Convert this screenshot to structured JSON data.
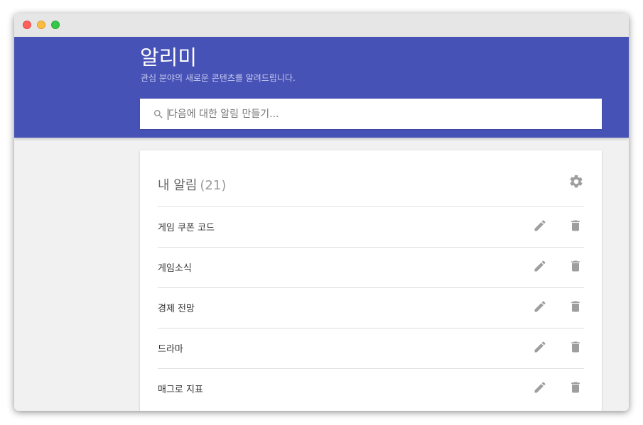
{
  "app": {
    "title": "알리미",
    "subtitle": "관심 분야의 새로운 콘텐츠를 알려드립니다."
  },
  "search": {
    "placeholder": "다음에 대한 알림 만들기...",
    "icon": "search-icon"
  },
  "alerts_card": {
    "title": "내 알림",
    "count": "(21)",
    "settings_icon": "gear-icon",
    "items": [
      {
        "label": "게임 쿠폰 코드"
      },
      {
        "label": "게임소식"
      },
      {
        "label": "경제 전망"
      },
      {
        "label": "드라마"
      },
      {
        "label": "매그로 지표"
      }
    ]
  },
  "colors": {
    "header": "#4752b6",
    "icon_gray": "#9e9e9e"
  }
}
